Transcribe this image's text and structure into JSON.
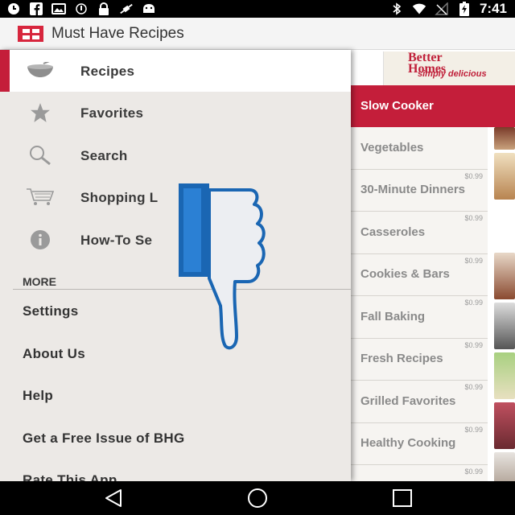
{
  "status_bar": {
    "time": "7:41",
    "left_icons": [
      "clock-icon",
      "facebook-icon",
      "photo-icon",
      "sync-icon",
      "lock-icon",
      "no-satellite-icon",
      "android-icon"
    ],
    "right_icons": [
      "bluetooth-icon",
      "wifi-icon",
      "no-signal-icon",
      "battery-charging-icon"
    ]
  },
  "app_bar": {
    "title": "Must Have Recipes",
    "logo_color": "#d7263d"
  },
  "drawer": {
    "items": [
      {
        "label": "Recipes",
        "icon": "bowl-icon",
        "selected": true
      },
      {
        "label": "Favorites",
        "icon": "star-icon",
        "selected": false
      },
      {
        "label": "Search",
        "icon": "search-icon",
        "selected": false
      },
      {
        "label": "Shopping L",
        "icon": "cart-icon",
        "selected": false
      },
      {
        "label": "How-To Se",
        "icon": "info-icon",
        "selected": false
      }
    ],
    "more_header": "MORE",
    "secondary_items": [
      "Settings",
      "About Us",
      "Help",
      "Get a Free Issue of BHG",
      "Rate This App"
    ],
    "accent_color": "#c41e3a"
  },
  "content": {
    "promo": {
      "line1": "Better",
      "line2": "Homes",
      "line3": "simply delicious"
    },
    "active_category": "Slow Cooker",
    "categories": [
      {
        "name": "Vegetables",
        "price": ""
      },
      {
        "name": "30-Minute Dinners",
        "price": "$0.99"
      },
      {
        "name": "Casseroles",
        "price": "$0.99"
      },
      {
        "name": "Cookies & Bars",
        "price": "$0.99"
      },
      {
        "name": "Fall Baking",
        "price": "$0.99"
      },
      {
        "name": "Fresh Recipes",
        "price": "$0.99"
      },
      {
        "name": "Grilled Favorites",
        "price": "$0.99"
      },
      {
        "name": "Healthy Cooking",
        "price": "$0.99"
      },
      {
        "name": "",
        "price": "$0.99"
      }
    ]
  },
  "overlay": {
    "icon": "thumbs-down-icon",
    "color": "#1a66b3"
  },
  "nav_bar": {
    "buttons": [
      "back-icon",
      "home-icon",
      "recents-icon"
    ]
  }
}
